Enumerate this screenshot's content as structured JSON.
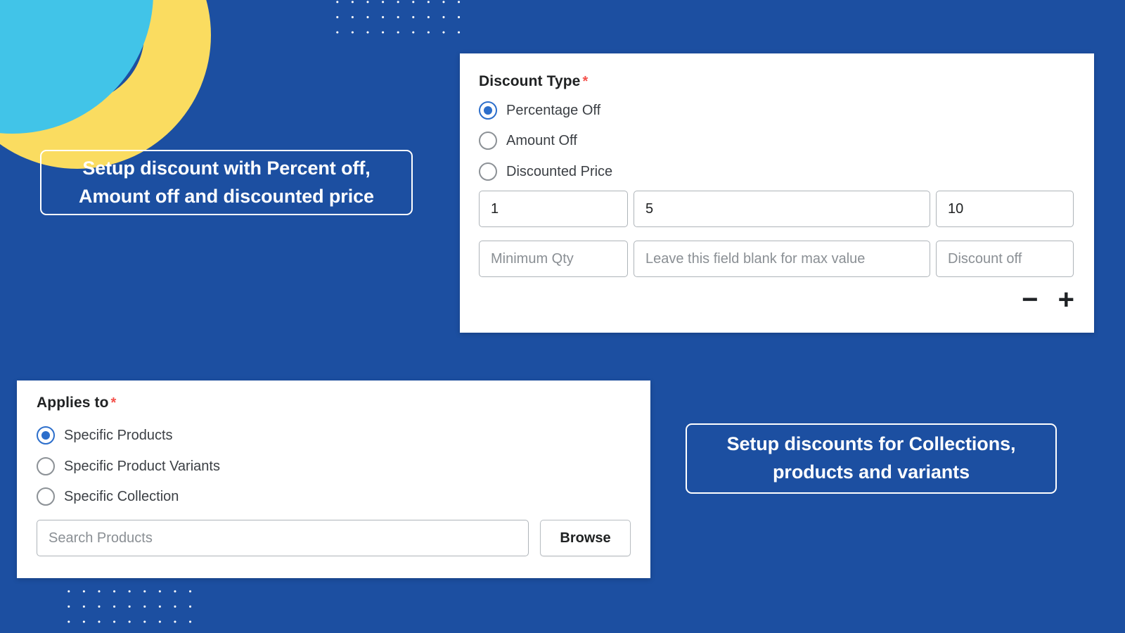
{
  "theme": {
    "background": "#1c4fa1",
    "accent_blue": "#2c6ecb",
    "decor_yellow": "#fadc60",
    "decor_cyan": "#41c4e8",
    "required_red": "#f4514b",
    "card_white": "#ffffff"
  },
  "decor": {
    "circle_cyan": "cyan-circle-shape",
    "ring_yellow": "yellow-ring-shape",
    "dot_grid_top": "dot-grid-pattern",
    "dot_grid_bottom": "dot-grid-pattern"
  },
  "callouts": {
    "left": "Setup discount with Percent off, Amount off and discounted price",
    "right": "Setup discounts for Collections, products and variants"
  },
  "discount_card": {
    "label": "Discount Type",
    "required_mark": "*",
    "options": [
      {
        "label": "Percentage Off",
        "selected": true
      },
      {
        "label": "Amount Off",
        "selected": false
      },
      {
        "label": "Discounted Price",
        "selected": false
      }
    ],
    "rows": [
      {
        "fields": [
          {
            "name": "min-qty",
            "value": "1",
            "placeholder": ""
          },
          {
            "name": "max-qty",
            "value": "5",
            "placeholder": ""
          },
          {
            "name": "discount-value",
            "value": "10",
            "placeholder": ""
          }
        ]
      },
      {
        "fields": [
          {
            "name": "min-qty",
            "value": "",
            "placeholder": "Minimum Qty"
          },
          {
            "name": "max-qty",
            "value": "",
            "placeholder": "Leave this field blank for max value"
          },
          {
            "name": "discount-value",
            "value": "",
            "placeholder": "Discount off"
          }
        ]
      }
    ],
    "stepper": {
      "remove": "−",
      "add": "+"
    }
  },
  "applies_card": {
    "label": "Applies to",
    "required_mark": "*",
    "options": [
      {
        "label": "Specific Products",
        "selected": true
      },
      {
        "label": "Specific Product Variants",
        "selected": false
      },
      {
        "label": "Specific Collection",
        "selected": false
      }
    ],
    "search": {
      "value": "",
      "placeholder": "Search Products"
    },
    "browse_label": "Browse"
  }
}
